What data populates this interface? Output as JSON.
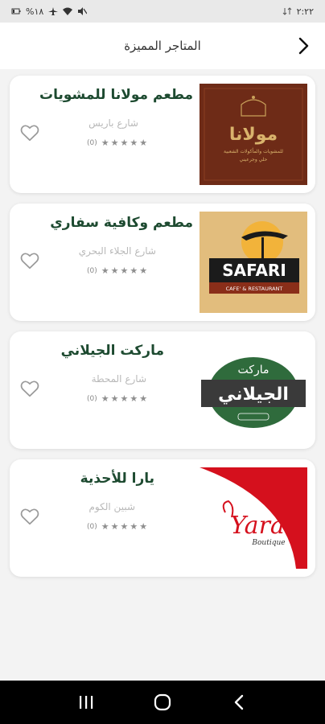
{
  "status_bar": {
    "time": "٢:٢٢",
    "battery": "%١٨",
    "icons": [
      "battery-icon",
      "airplane-icon",
      "wifi-icon",
      "mute-icon",
      "data-icon"
    ]
  },
  "header": {
    "title": "المتاجر المميزة",
    "back_icon": "chevron-right-icon"
  },
  "stores": [
    {
      "name": "مطعم مولانا للمشويات",
      "address": "شارع باريس",
      "rating": 0,
      "rating_count": "(0)",
      "logo": {
        "main": "مولانا",
        "sub1": "للمشويات والمأكولات الشعبية",
        "sub2": "حلي وجرعيني",
        "bg": "#6b2a18"
      }
    },
    {
      "name": "مطعم وكافية سفاري",
      "address": "شارع الجلاء البحري",
      "rating": 0,
      "rating_count": "(0)",
      "logo": {
        "main": "SAFARI",
        "sub": "CAFE' & RESTAURANT",
        "bg": "#e9c98f"
      }
    },
    {
      "name": "ماركت الجيلاني",
      "address": "شارع المحطة",
      "rating": 0,
      "rating_count": "(0)",
      "logo": {
        "top": "ماركت",
        "main": "الجيلاني",
        "color": "#2f6b3c"
      }
    },
    {
      "name": "يارا للأحذية",
      "address": "شبين الكوم",
      "rating": 0,
      "rating_count": "(0)",
      "logo": {
        "main": "Yara",
        "sub": "Boutique",
        "color": "#d5101d"
      }
    }
  ],
  "colors": {
    "accent": "#1d4a30",
    "background": "#f3f3f3",
    "card": "#ffffff"
  }
}
